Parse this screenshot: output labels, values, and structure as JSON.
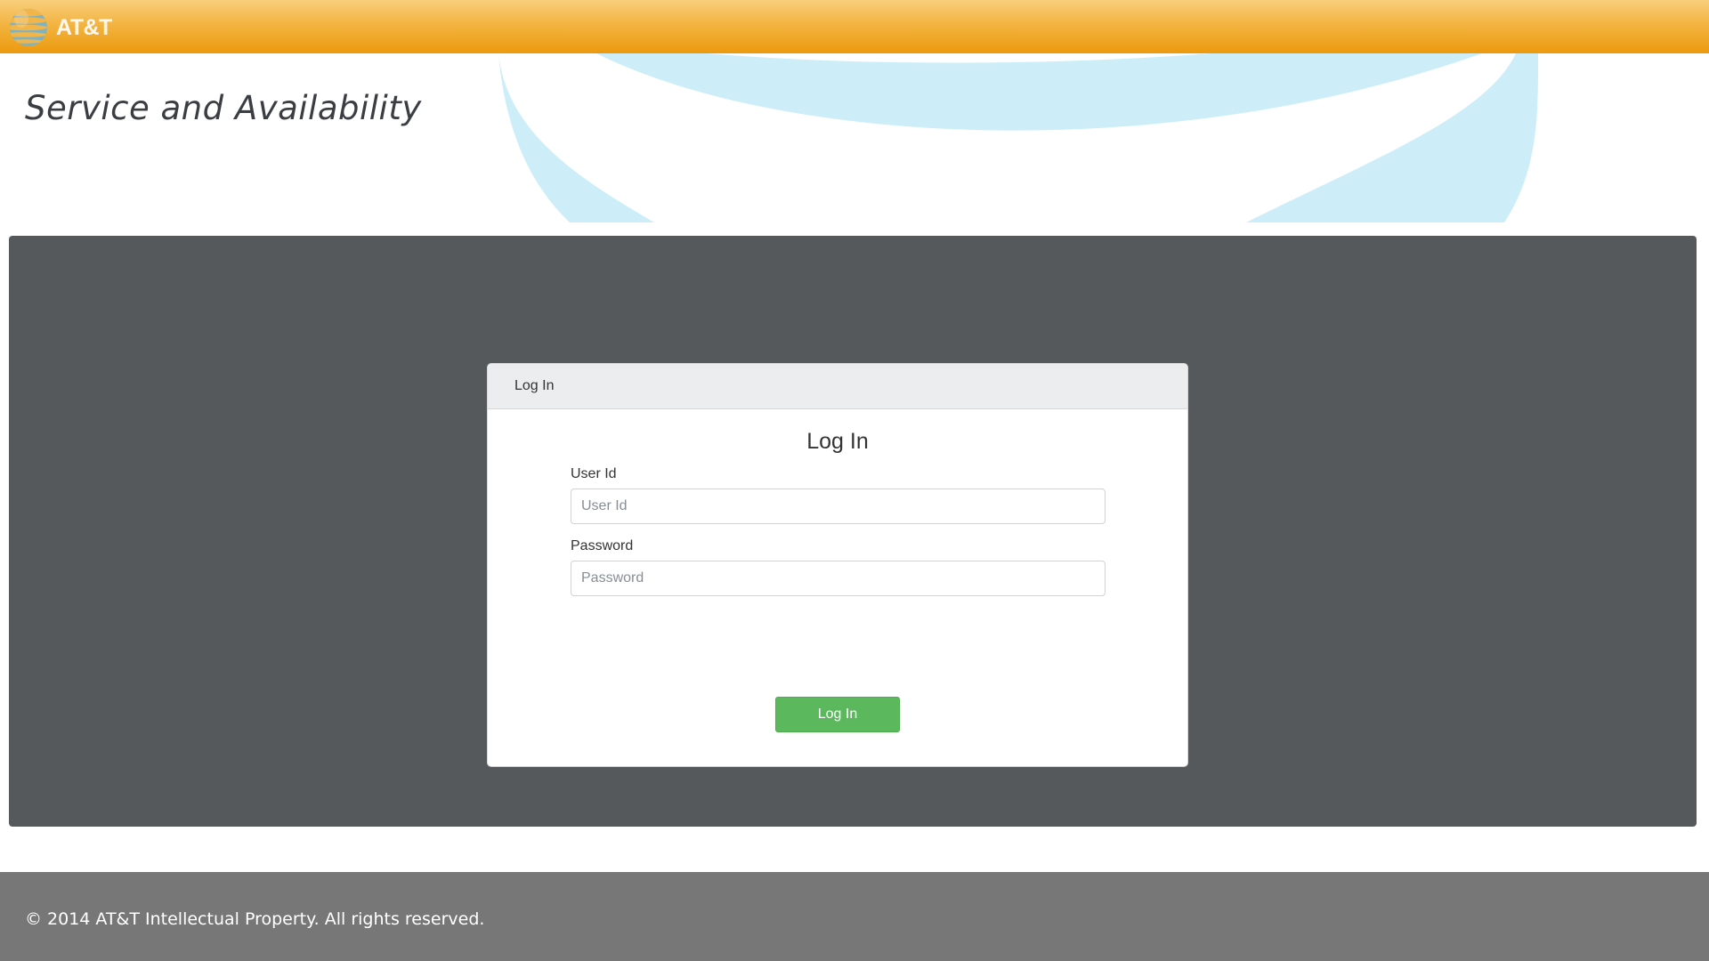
{
  "header": {
    "brand_text": "AT&T",
    "logo_icon": "att-globe-icon",
    "background_color": "#f0a21a"
  },
  "hero": {
    "title": "Service and Availability",
    "art_color": "#cdeef8"
  },
  "login_card": {
    "header_label": "Log In",
    "title": "Log In",
    "user_id": {
      "label": "User Id",
      "placeholder": "User Id",
      "value": ""
    },
    "password": {
      "label": "Password",
      "placeholder": "Password",
      "value": ""
    },
    "submit_label": "Log In",
    "submit_color": "#5cb85c"
  },
  "footer": {
    "copyright": "© 2014 AT&T Intellectual Property. All rights reserved."
  }
}
